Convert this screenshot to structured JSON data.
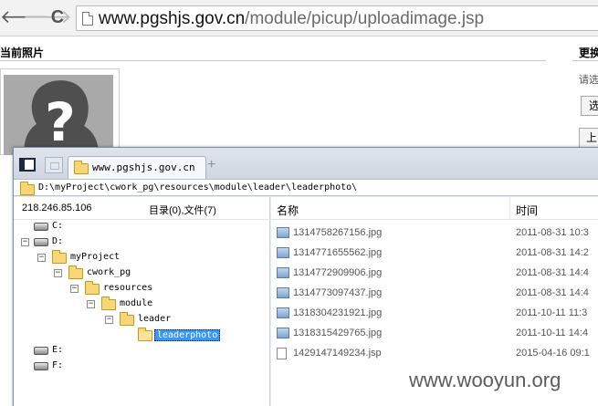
{
  "browser": {
    "url_host": "www.pgshjs.gov.cn",
    "url_path": "/module/picup/uploadimage.jsp",
    "back_glyph": "🡐",
    "forward_glyph": "🡒",
    "reload_glyph": "C"
  },
  "page": {
    "section_title": "当前照片",
    "right_title": "更换",
    "right_hint": "请选",
    "right_button": "选",
    "right_button2": "上"
  },
  "file_browser": {
    "tab_label": "www.pgshjs.gov.cn",
    "tab_plus": "+",
    "path": "D:\\myProject\\cwork_pg\\resources\\module\\leader\\leaderphoto\\",
    "host_ip": "218.246.85.106",
    "dir_count": "目录(0),文件(7)",
    "tree": [
      {
        "label": "C:",
        "kind": "drive",
        "expander": ""
      },
      {
        "label": "D:",
        "kind": "drive",
        "expander": "−"
      },
      {
        "label": "myProject",
        "kind": "folder",
        "expander": "−"
      },
      {
        "label": "cwork_pg",
        "kind": "folder",
        "expander": "−"
      },
      {
        "label": "resources",
        "kind": "folder",
        "expander": "−"
      },
      {
        "label": "module",
        "kind": "folder",
        "expander": "−"
      },
      {
        "label": "leader",
        "kind": "folder",
        "expander": "−"
      },
      {
        "label": "leaderphoto",
        "kind": "folder-open",
        "expander": "",
        "selected": true
      },
      {
        "label": "E:",
        "kind": "drive",
        "expander": ""
      },
      {
        "label": "F:",
        "kind": "drive",
        "expander": ""
      }
    ],
    "columns": {
      "name": "名称",
      "time": "时间"
    },
    "files": [
      {
        "name": "1314758267156.jpg",
        "time": "2011-08-31 10:3"
      },
      {
        "name": "1314771655562.jpg",
        "time": "2011-08-31 14:2"
      },
      {
        "name": "1314772909906.jpg",
        "time": "2011-08-31 14:4"
      },
      {
        "name": "1314773097437.jpg",
        "time": "2011-08-31 14:4"
      },
      {
        "name": "1318304231921.jpg",
        "time": "2011-10-11 11:3"
      },
      {
        "name": "1318315429765.jpg",
        "time": "2011-10-11 14:4"
      },
      {
        "name": "1429147149234.jsp",
        "time": "2015-04-16 09:1"
      }
    ]
  },
  "watermark": "www.wooyun.org",
  "colors": {
    "selection": "#3399ff",
    "folder": "#f7d774",
    "window_border": "#7a8da6"
  }
}
